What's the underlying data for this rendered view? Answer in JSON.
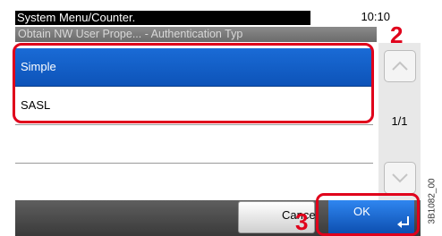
{
  "header": {
    "title": "System Menu/Counter.",
    "time": "10:10",
    "subtitle": "Obtain NW User Prope... - Authentication Typ"
  },
  "list": {
    "items": [
      {
        "label": "Simple",
        "selected": true
      },
      {
        "label": "SASL",
        "selected": false
      },
      {
        "label": "",
        "selected": false
      },
      {
        "label": "",
        "selected": false
      }
    ]
  },
  "scroll": {
    "page_indicator": "1/1",
    "up_icon": "chevron-up-icon",
    "down_icon": "chevron-down-icon"
  },
  "footer": {
    "cancel_label": "Cancel",
    "ok_label": "OK",
    "ok_icon": "enter-return-icon"
  },
  "callouts": {
    "step_2": "2",
    "step_3": "3",
    "color": "#e0001b"
  },
  "figure_id": "3B1082_00"
}
